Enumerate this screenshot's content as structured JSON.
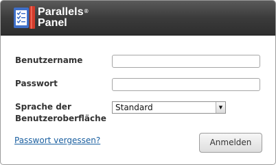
{
  "header": {
    "brand_line1": "Parallels",
    "brand_reg": "®",
    "brand_line2": "Panel",
    "logo_icon": "parallels-checklist-logo"
  },
  "form": {
    "username_label": "Benutzername",
    "username_value": "",
    "password_label": "Passwort",
    "password_value": "",
    "language_label_line1": "Sprache der",
    "language_label_line2": "Benutzeroberfläche",
    "language_selected": "Standard",
    "forgot_password_link": "Passwort vergessen?",
    "login_button": "Anmelden"
  },
  "colors": {
    "header_bg": "#3b3b3b",
    "logo_blue": "#3f6fc8",
    "logo_red": "#d23c2c",
    "link": "#1a5fa0"
  }
}
